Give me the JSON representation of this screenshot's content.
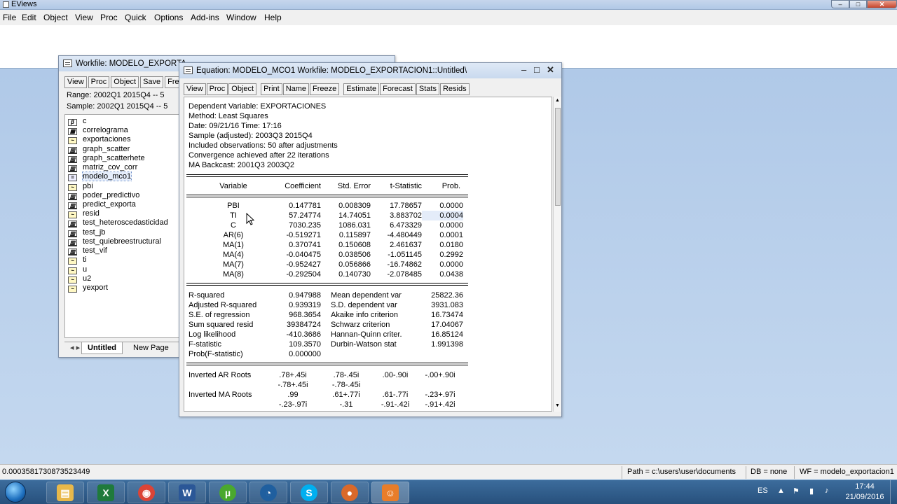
{
  "app": {
    "title": "EViews"
  },
  "menu": [
    "File",
    "Edit",
    "Object",
    "View",
    "Proc",
    "Quick",
    "Options",
    "Add-ins",
    "Window",
    "Help"
  ],
  "workfile": {
    "title": "Workfile: MODELO_EXPORTA",
    "toolbar": [
      "View",
      "Proc",
      "Object",
      "Save",
      "Freeze"
    ],
    "range_label": "Range:",
    "range_value": "2002Q1 2015Q4",
    "range_suffix": "--  5",
    "sample_label": "Sample:",
    "sample_value": "2002Q1 2015Q4",
    "sample_suffix": "--  5",
    "objects": [
      {
        "name": "c",
        "type": "coef"
      },
      {
        "name": "correlograma",
        "type": "table"
      },
      {
        "name": "exportaciones",
        "type": "series"
      },
      {
        "name": "graph_scatter",
        "type": "graph"
      },
      {
        "name": "graph_scatterhete",
        "type": "graph"
      },
      {
        "name": "matriz_cov_corr",
        "type": "graph"
      },
      {
        "name": "modelo_mco1",
        "type": "equation"
      },
      {
        "name": "pbi",
        "type": "series"
      },
      {
        "name": "poder_predictivo",
        "type": "graph"
      },
      {
        "name": "predict_exporta",
        "type": "graph"
      },
      {
        "name": "resid",
        "type": "series"
      },
      {
        "name": "test_heteroscedasticidad",
        "type": "graph"
      },
      {
        "name": "test_jb",
        "type": "graph"
      },
      {
        "name": "test_quiebreestructural",
        "type": "graph"
      },
      {
        "name": "test_vif",
        "type": "graph"
      },
      {
        "name": "ti",
        "type": "series"
      },
      {
        "name": "u",
        "type": "series"
      },
      {
        "name": "u2",
        "type": "series"
      },
      {
        "name": "yexport",
        "type": "series"
      }
    ],
    "tabs": [
      "Untitled",
      "New Page"
    ]
  },
  "equation": {
    "title": "Equation: MODELO_MCO1   Workfile: MODELO_EXPORTACION1::Untitled\\",
    "toolbar": [
      "View",
      "Proc",
      "Object",
      "Print",
      "Name",
      "Freeze",
      "Estimate",
      "Forecast",
      "Stats",
      "Resids"
    ],
    "header": [
      "Dependent Variable: EXPORTACIONES",
      "Method: Least Squares",
      "Date: 09/21/16   Time: 17:16",
      "Sample (adjusted): 2003Q3 2015Q4",
      "Included observations: 50 after adjustments",
      "Convergence achieved after 22 iterations",
      "MA Backcast: 2001Q3 2003Q2"
    ],
    "columns": [
      "Variable",
      "Coefficient",
      "Std. Error",
      "t-Statistic",
      "Prob."
    ],
    "rows": [
      {
        "variable": "PBI",
        "coefficient": "0.147781",
        "std_error": "0.008309",
        "t_statistic": "17.78657",
        "prob": "0.0000"
      },
      {
        "variable": "TI",
        "coefficient": "57.24774",
        "std_error": "14.74051",
        "t_statistic": "3.883702",
        "prob": "0.0004"
      },
      {
        "variable": "C",
        "coefficient": "7030.235",
        "std_error": "1086.031",
        "t_statistic": "6.473329",
        "prob": "0.0000"
      },
      {
        "variable": "AR(6)",
        "coefficient": "-0.519271",
        "std_error": "0.115897",
        "t_statistic": "-4.480449",
        "prob": "0.0001"
      },
      {
        "variable": "MA(1)",
        "coefficient": "0.370741",
        "std_error": "0.150608",
        "t_statistic": "2.461637",
        "prob": "0.0180"
      },
      {
        "variable": "MA(4)",
        "coefficient": "-0.040475",
        "std_error": "0.038506",
        "t_statistic": "-1.051145",
        "prob": "0.2992"
      },
      {
        "variable": "MA(7)",
        "coefficient": "-0.952427",
        "std_error": "0.056866",
        "t_statistic": "-16.74862",
        "prob": "0.0000"
      },
      {
        "variable": "MA(8)",
        "coefficient": "-0.292504",
        "std_error": "0.140730",
        "t_statistic": "-2.078485",
        "prob": "0.0438"
      }
    ],
    "stats": [
      {
        "label": "R-squared",
        "value": "0.947988",
        "label2": "Mean dependent var",
        "value2": "25822.36"
      },
      {
        "label": "Adjusted R-squared",
        "value": "0.939319",
        "label2": "S.D. dependent var",
        "value2": "3931.083"
      },
      {
        "label": "S.E. of regression",
        "value": "968.3654",
        "label2": "Akaike info criterion",
        "value2": "16.73474"
      },
      {
        "label": "Sum squared resid",
        "value": "39384724",
        "label2": "Schwarz criterion",
        "value2": "17.04067"
      },
      {
        "label": "Log likelihood",
        "value": "-410.3686",
        "label2": "Hannan-Quinn criter.",
        "value2": "16.85124"
      },
      {
        "label": "F-statistic",
        "value": "109.3570",
        "label2": "Durbin-Watson stat",
        "value2": "1.991398"
      },
      {
        "label": "Prob(F-statistic)",
        "value": "0.000000",
        "label2": "",
        "value2": ""
      }
    ],
    "roots": [
      {
        "label": "Inverted AR Roots",
        "values": [
          ".78+.45i",
          ".78-.45i",
          ".00-.90i",
          "-.00+.90i"
        ]
      },
      {
        "label": "",
        "values": [
          "-.78+.45i",
          "-.78-.45i",
          "",
          ""
        ]
      },
      {
        "label": "Inverted MA Roots",
        "values": [
          ".99",
          ".61+.77i",
          ".61-.77i",
          "-.23+.97i"
        ]
      },
      {
        "label": "",
        "values": [
          "-.23-.97i",
          "-.31",
          "-.91-.42i",
          "-.91+.42i"
        ]
      }
    ]
  },
  "statusbar": {
    "value": "0.0003581730873523449",
    "path": "Path = c:\\users\\user\\documents",
    "db": "DB = none",
    "wf": "WF = modelo_exportacion1"
  },
  "taskbar": {
    "apps": [
      {
        "name": "explorer",
        "glyph": "▤",
        "color": "#e8b84a"
      },
      {
        "name": "excel",
        "glyph": "X",
        "color": "#1f7a3c"
      },
      {
        "name": "chrome",
        "glyph": "◉",
        "color": "#db4437"
      },
      {
        "name": "word",
        "glyph": "W",
        "color": "#2b5797"
      },
      {
        "name": "utorrent",
        "glyph": "µ",
        "color": "#4aa82e"
      },
      {
        "name": "speed",
        "glyph": "◔",
        "color": "#1f5f9f"
      },
      {
        "name": "skype",
        "glyph": "S",
        "color": "#00aff0"
      },
      {
        "name": "app-ball",
        "glyph": "●",
        "color": "#d9692a"
      },
      {
        "name": "app-people",
        "glyph": "☺",
        "color": "#e87d2a"
      }
    ],
    "language": "ES",
    "time": "17:44",
    "date": "21/09/2016"
  }
}
